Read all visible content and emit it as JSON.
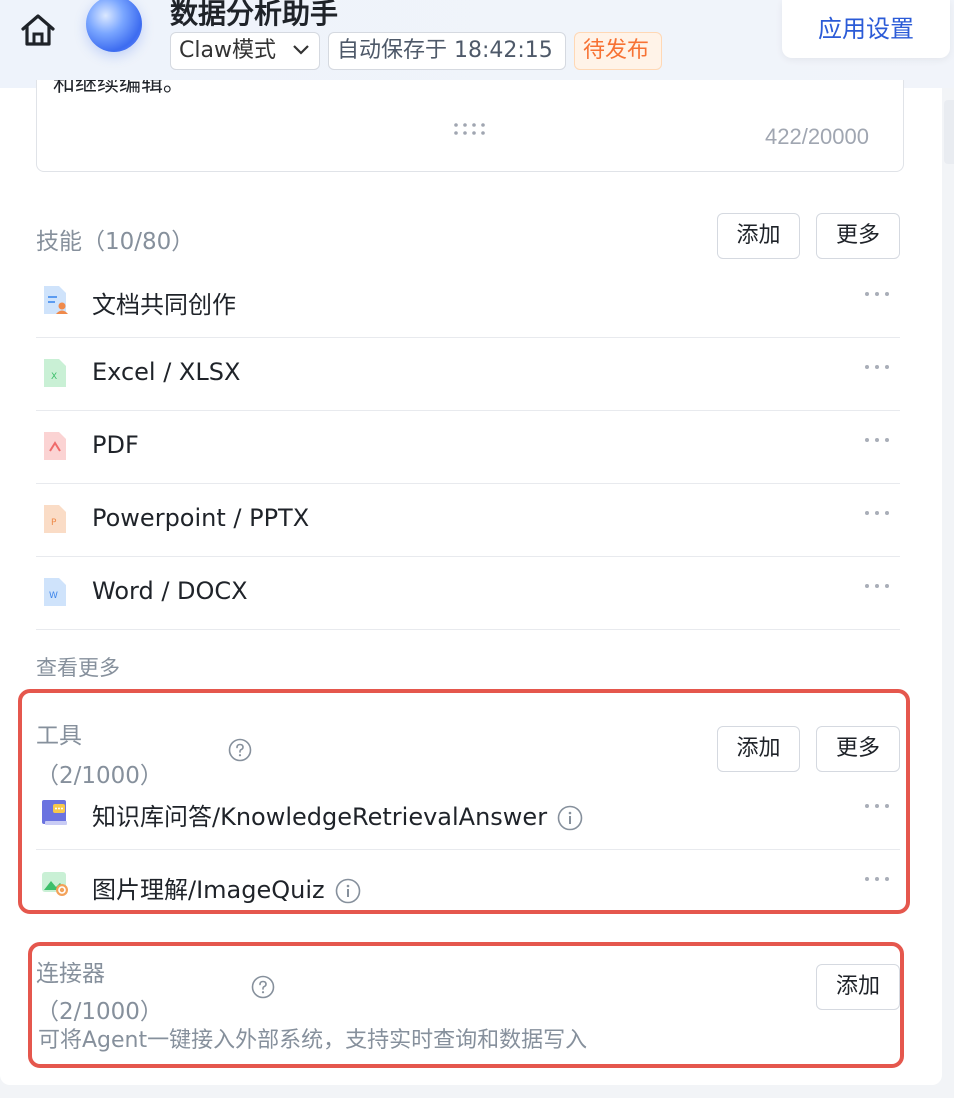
{
  "header": {
    "home_icon": "home-icon",
    "app_name": "数据分析助手",
    "mode_label": "Claw模式",
    "autosave_text": "自动保存于 18:42:15",
    "status_badge": "待发布",
    "settings_button": "应用设置"
  },
  "prompt": {
    "tail_text": "和继续编辑。",
    "counter": "422/20000"
  },
  "skills": {
    "title": "技能（10/80）",
    "add_label": "添加",
    "more_label": "更多",
    "items": [
      {
        "label": "文档共同创作",
        "icon": "doc-collab-icon"
      },
      {
        "label": "Excel / XLSX",
        "icon": "excel-file-icon"
      },
      {
        "label": "PDF",
        "icon": "pdf-file-icon"
      },
      {
        "label": "Powerpoint / PPTX",
        "icon": "ppt-file-icon"
      },
      {
        "label": "Word / DOCX",
        "icon": "word-file-icon"
      }
    ],
    "see_more": "查看更多"
  },
  "tools": {
    "title": "工具",
    "count": "（2/1000）",
    "add_label": "添加",
    "more_label": "更多",
    "items": [
      {
        "label": "知识库问答/KnowledgeRetrievalAnswer",
        "icon": "knowledge-book-icon"
      },
      {
        "label": "图片理解/ImageQuiz",
        "icon": "image-understanding-icon"
      }
    ]
  },
  "connectors": {
    "title": "连接器",
    "count": "（2/1000）",
    "add_label": "添加",
    "description": "可将Agent一键接入外部系统，支持实时查询和数据写入"
  },
  "colors": {
    "accent": "#2b5bd7",
    "status_orange": "#f77234",
    "highlight_red": "#e5574d"
  }
}
